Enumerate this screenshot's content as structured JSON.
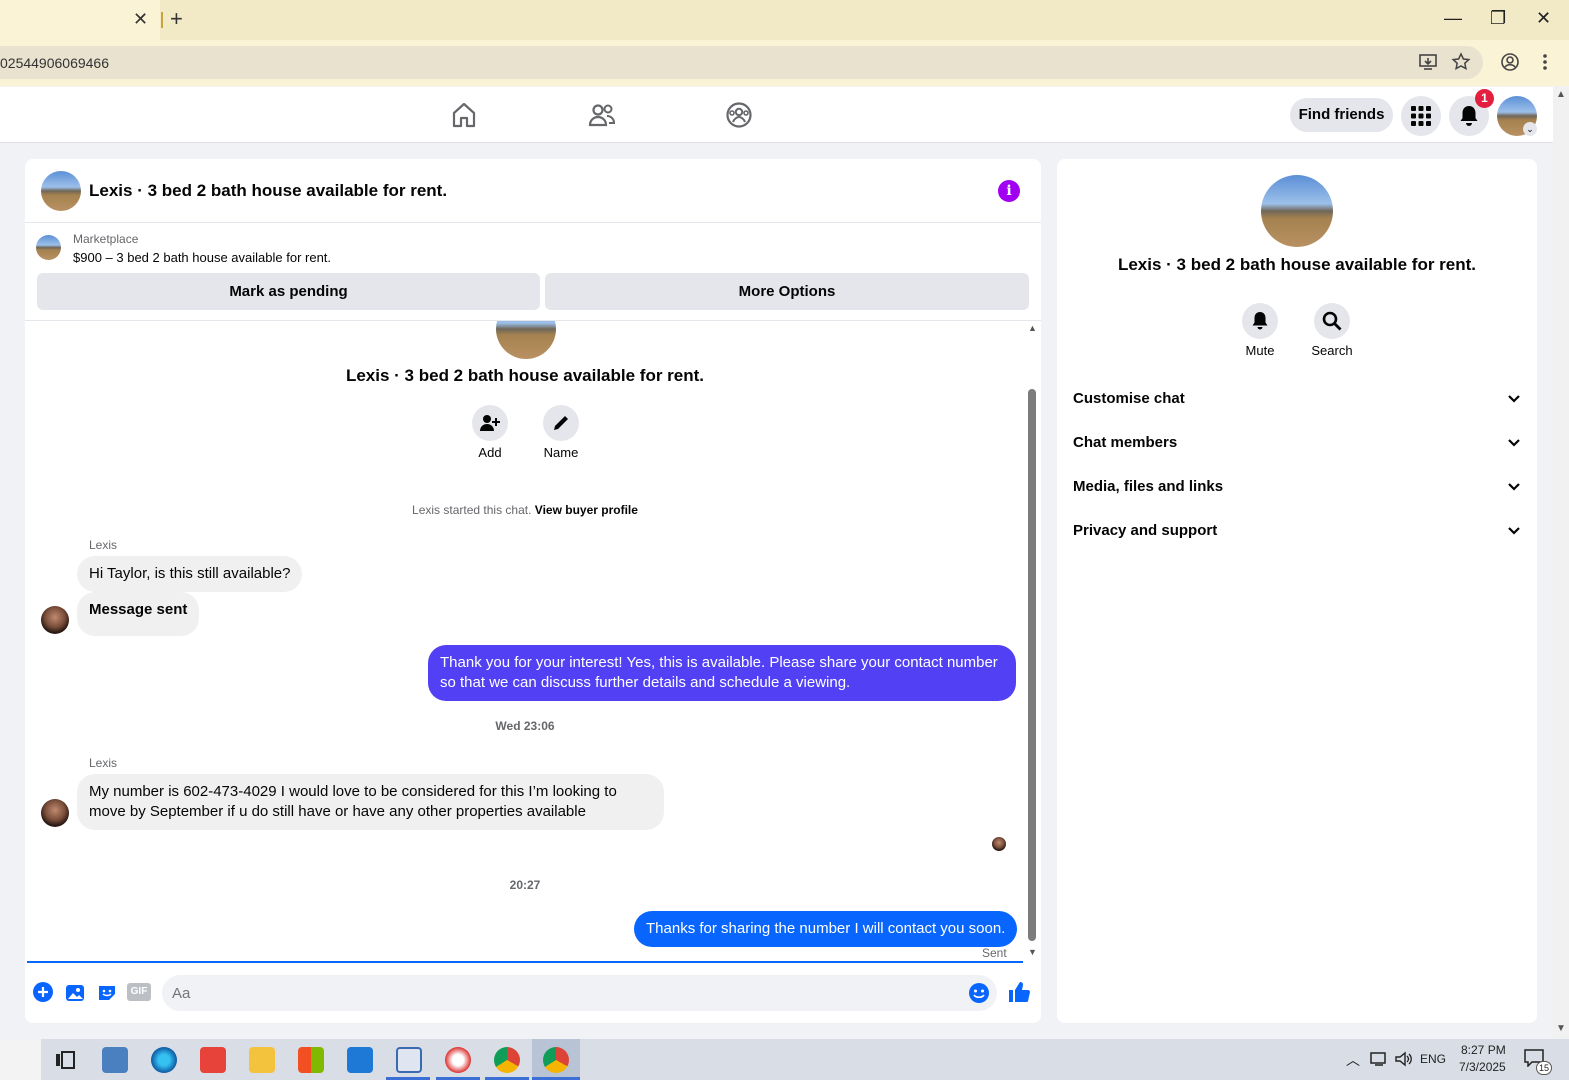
{
  "browser": {
    "url": "02544906069466",
    "tab_close": "✕",
    "new_tab": "+",
    "minimize": "—",
    "restore": "❐",
    "close": "✕"
  },
  "nav": {
    "find_friends": "Find friends",
    "notification_count": "1"
  },
  "chat": {
    "header_title": "Lexis · 3 bed 2 bath house available for rent.",
    "info_icon": "i",
    "marketplace_label": "Marketplace",
    "listing": "$900 – 3 bed 2 bath house available for rent.",
    "mark_pending": "Mark as pending",
    "more_options": "More Options",
    "center_title": "Lexis · 3 bed 2 bath house available for rent.",
    "add_label": "Add",
    "name_label": "Name",
    "started_note": "Lexis started this chat.",
    "view_buyer_profile": "View buyer profile",
    "messages": [
      {
        "sender": "Lexis",
        "text": "Hi Taylor, is this still available?"
      },
      {
        "text": "Message sent"
      },
      {
        "text": "Thank you for your interest! Yes, this is available. Please share your contact number so that we can discuss further details and schedule a viewing."
      },
      {
        "time": "Wed 23:06"
      },
      {
        "sender": "Lexis",
        "text": "My number is 602-473-4029 I would love to be considered for this I’m looking to move by September if u do still have or have any other properties available"
      },
      {
        "time": "20:27"
      },
      {
        "text": "Thanks for sharing the number I will contact you soon."
      }
    ],
    "sent_status": "Sent",
    "input_placeholder": "Aa",
    "gif_label": "GIF",
    "colors": {
      "out_purple": "#5240f5",
      "out_blue": "#0866ff"
    }
  },
  "info_panel": {
    "title": "Lexis · 3 bed 2 bath house available for rent.",
    "mute": "Mute",
    "search": "Search",
    "rows": [
      "Customise chat",
      "Chat members",
      "Media, files and links",
      "Privacy and support"
    ]
  },
  "taskbar": {
    "language": "ENG",
    "time": "8:27 PM",
    "date": "7/3/2025",
    "notifications": "15"
  }
}
